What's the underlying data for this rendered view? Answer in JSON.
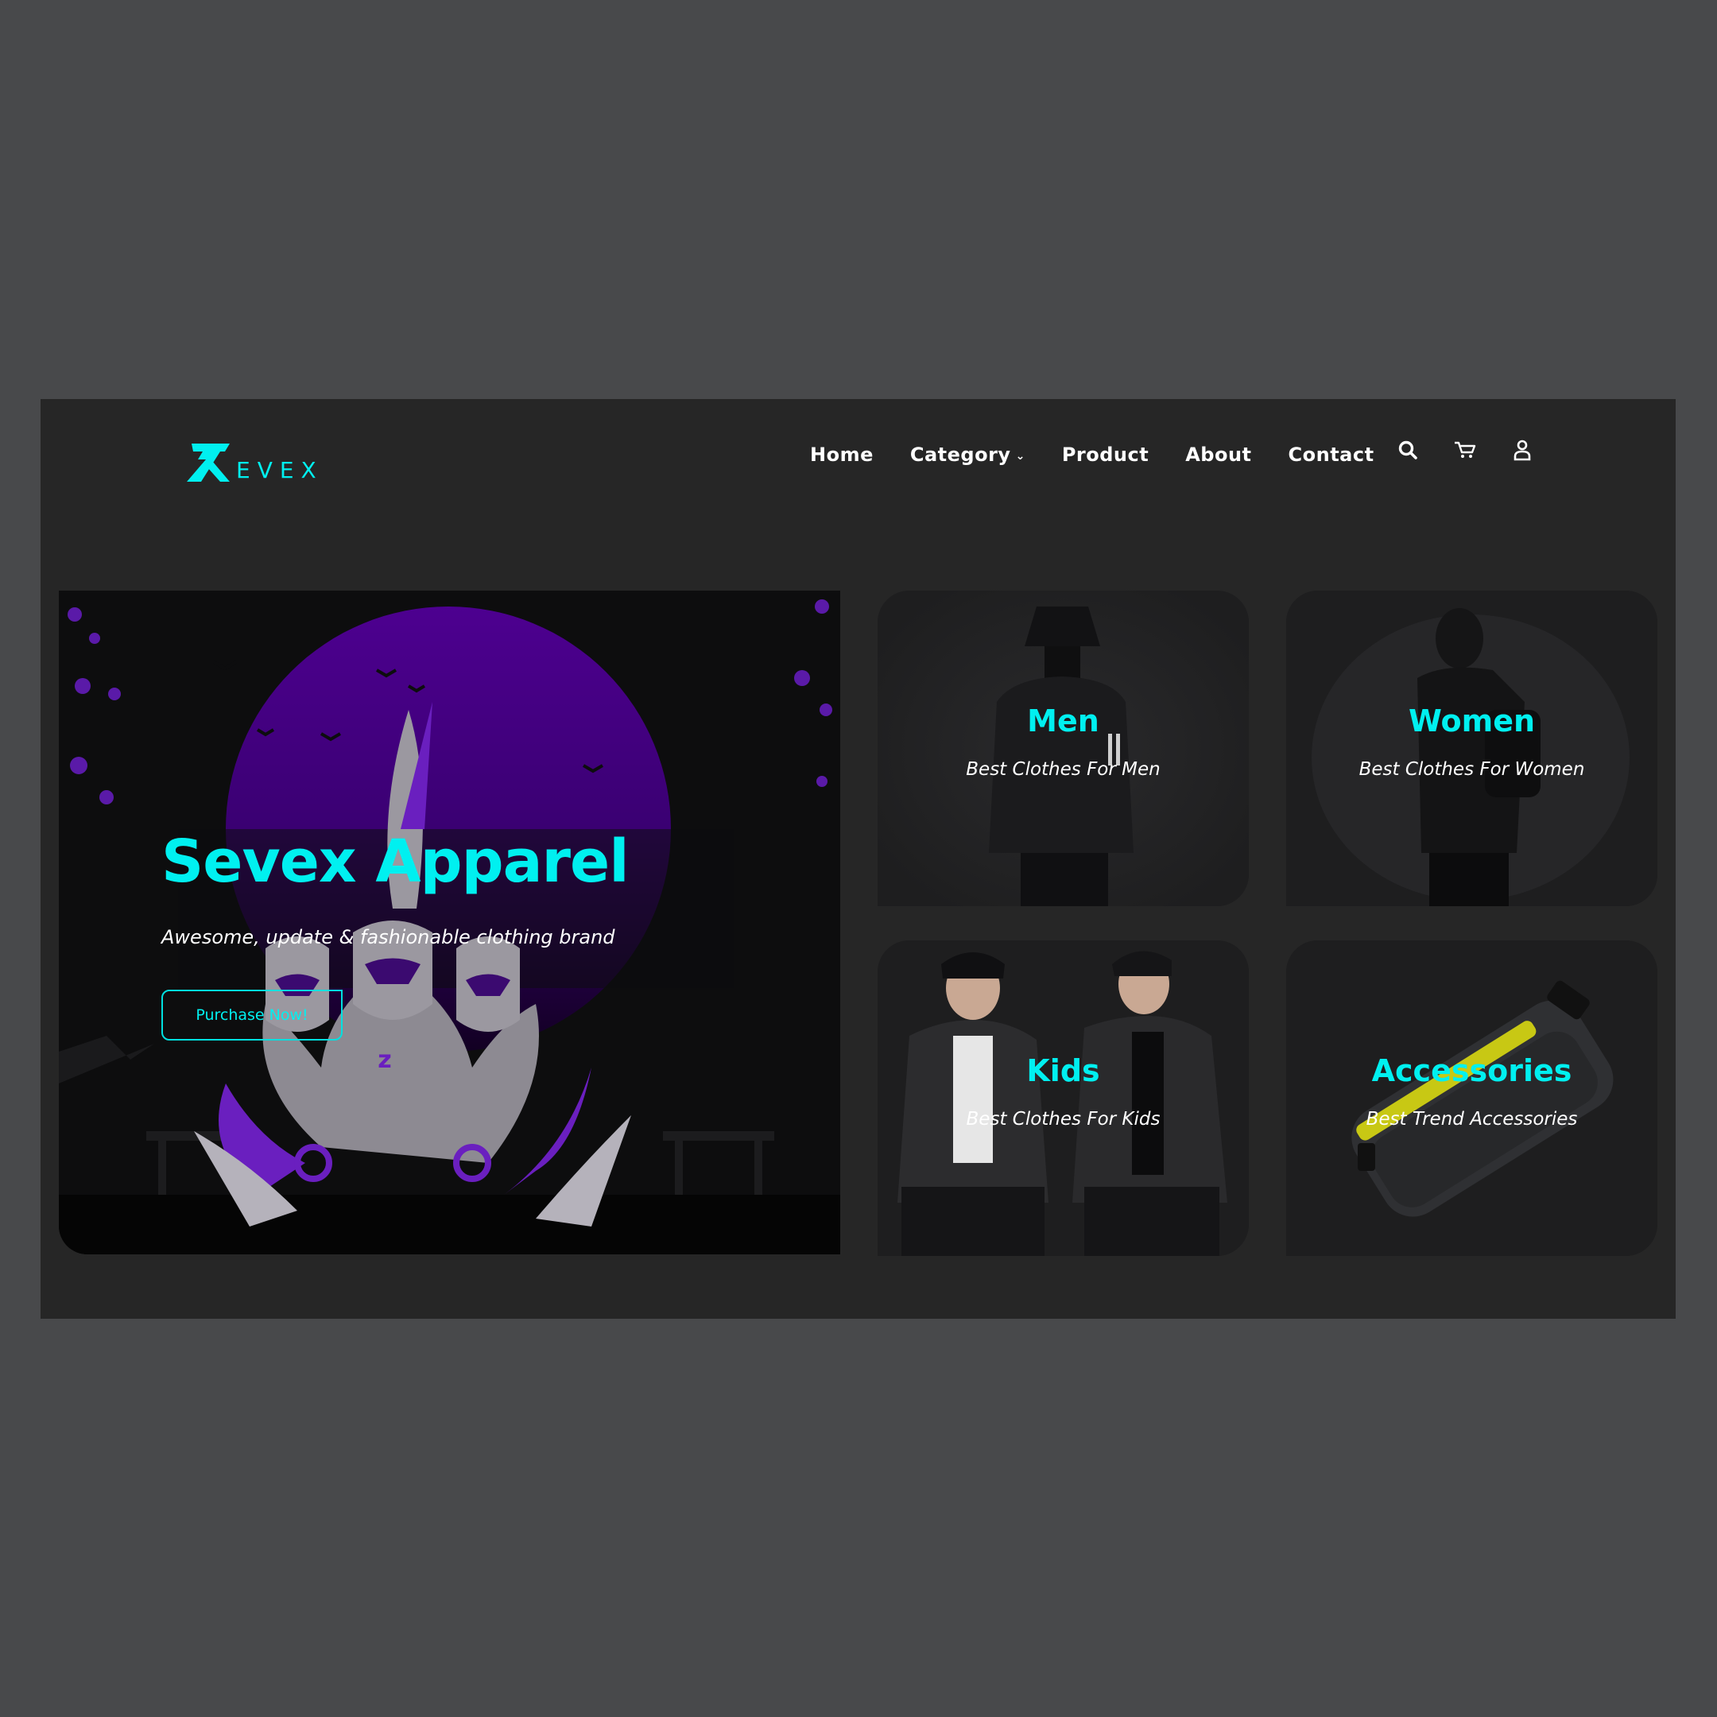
{
  "header": {
    "logo_text": "EVEX",
    "nav": [
      {
        "label": "Home"
      },
      {
        "label": "Category"
      },
      {
        "label": "Product"
      },
      {
        "label": "About"
      },
      {
        "label": "Contact"
      }
    ],
    "icons": [
      "search-icon",
      "cart-icon",
      "user-icon"
    ]
  },
  "hero": {
    "title": "Sevex Apparel",
    "subtitle": "Awesome, update & fashionable clothing brand",
    "cta_label": "Purchase Now!"
  },
  "categories": [
    {
      "title": "Men",
      "subtitle": "Best Clothes For Men"
    },
    {
      "title": "Women",
      "subtitle": "Best Clothes For Women"
    },
    {
      "title": "Kids",
      "subtitle": "Best Clothes For Kids"
    },
    {
      "title": "Accessories",
      "subtitle": "Best Trend Accessories"
    }
  ],
  "colors": {
    "accent": "#00f0f0",
    "background": "#48494b",
    "panel": "#262626",
    "purple": "#4b0082"
  }
}
